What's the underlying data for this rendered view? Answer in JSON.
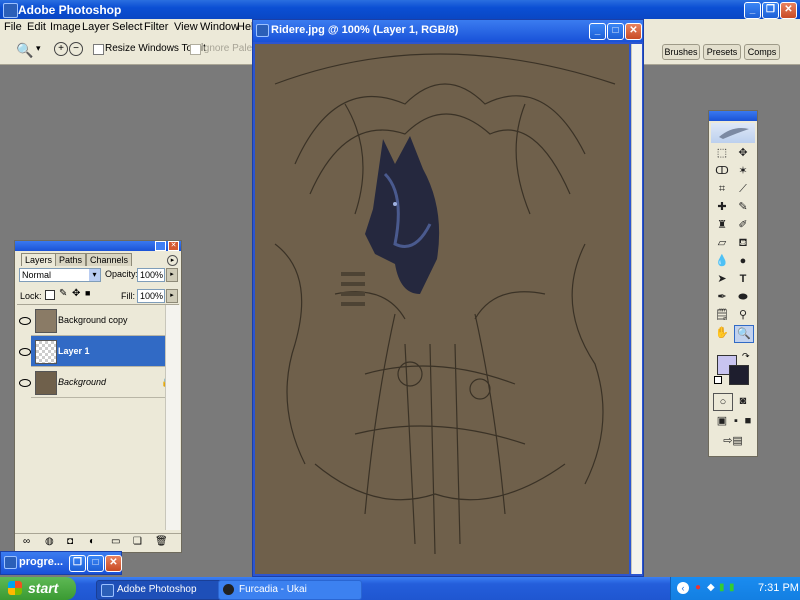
{
  "app": {
    "title": "Adobe Photoshop"
  },
  "menu": [
    "File",
    "Edit",
    "Image",
    "Layer",
    "Select",
    "Filter",
    "View",
    "Window",
    "Hel"
  ],
  "options": {
    "resize_label": "Resize Windows To Fit",
    "ignore_label": "Ignore Palette"
  },
  "dock_tabs": [
    "Brushes",
    "Presets",
    "Comps"
  ],
  "document": {
    "title": "Ridere.jpg @ 100% (Layer 1, RGB/8)"
  },
  "layers_panel": {
    "tabs": [
      "Layers",
      "Paths",
      "Channels"
    ],
    "blend_mode": "Normal",
    "opacity_label": "Opacity:",
    "opacity_value": "100%",
    "lock_label": "Lock:",
    "fill_label": "Fill:",
    "fill_value": "100%",
    "layers": [
      {
        "name": "Background copy",
        "selected": false
      },
      {
        "name": "Layer 1",
        "selected": true
      },
      {
        "name": "Background",
        "selected": false,
        "locked": true
      }
    ]
  },
  "colors": {
    "foreground": "#c8c4f0",
    "background": "#1e1e2e",
    "canvas": "#6f604b",
    "selection": "#316ac5"
  },
  "minimized_window": {
    "title": "progre..."
  },
  "taskbar": {
    "start_label": "start",
    "tasks": [
      "Adobe Photoshop",
      "Furcadia - Ukai"
    ],
    "clock": "7:31 PM"
  }
}
